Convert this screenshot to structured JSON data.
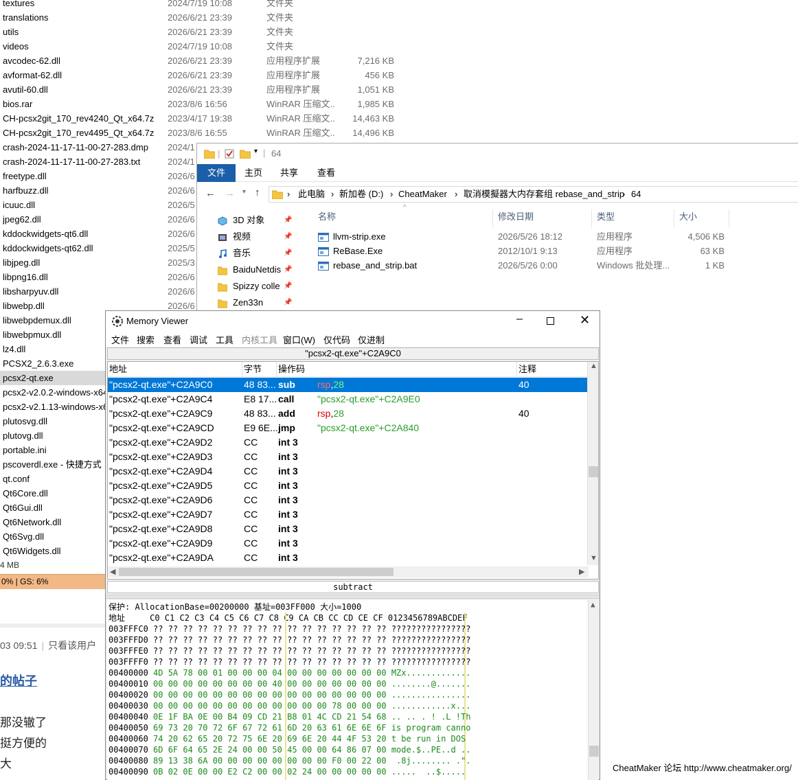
{
  "background_files": {
    "rows": [
      {
        "name": "textures",
        "date": "2024/7/19 10:08",
        "type": "文件夹",
        "size": ""
      },
      {
        "name": "translations",
        "date": "2026/6/21 23:39",
        "type": "文件夹",
        "size": ""
      },
      {
        "name": "utils",
        "date": "2026/6/21 23:39",
        "type": "文件夹",
        "size": ""
      },
      {
        "name": "videos",
        "date": "2024/7/19 10:08",
        "type": "文件夹",
        "size": ""
      },
      {
        "name": "avcodec-62.dll",
        "date": "2026/6/21 23:39",
        "type": "应用程序扩展",
        "size": "7,216 KB"
      },
      {
        "name": "avformat-62.dll",
        "date": "2026/6/21 23:39",
        "type": "应用程序扩展",
        "size": "456 KB"
      },
      {
        "name": "avutil-60.dll",
        "date": "2026/6/21 23:39",
        "type": "应用程序扩展",
        "size": "1,051 KB"
      },
      {
        "name": "bios.rar",
        "date": "2023/8/6 16:56",
        "type": "WinRAR 压缩文...",
        "size": "1,985 KB"
      },
      {
        "name": "CH-pcsx2git_170_rev4240_Qt_x64.7z",
        "date": "2023/4/17 19:38",
        "type": "WinRAR 压缩文...",
        "size": "14,463 KB"
      },
      {
        "name": "CH-pcsx2git_170_rev4495_Qt_x64.7z",
        "date": "2023/8/6 16:55",
        "type": "WinRAR 压缩文...",
        "size": "14,496 KB"
      },
      {
        "name": "crash-2024-11-17-11-00-27-283.dmp",
        "date": "2024/1",
        "type": "",
        "size": ""
      },
      {
        "name": "crash-2024-11-17-11-00-27-283.txt",
        "date": "2024/1",
        "type": "",
        "size": ""
      },
      {
        "name": "freetype.dll",
        "date": "2026/6",
        "type": "",
        "size": ""
      },
      {
        "name": "harfbuzz.dll",
        "date": "2026/6",
        "type": "",
        "size": ""
      },
      {
        "name": "icuuc.dll",
        "date": "2026/5",
        "type": "",
        "size": ""
      },
      {
        "name": "jpeg62.dll",
        "date": "2026/6",
        "type": "",
        "size": ""
      },
      {
        "name": "kddockwidgets-qt6.dll",
        "date": "2026/6",
        "type": "",
        "size": ""
      },
      {
        "name": "kddockwidgets-qt62.dll",
        "date": "2025/5",
        "type": "",
        "size": ""
      },
      {
        "name": "libjpeg.dll",
        "date": "2025/3",
        "type": "",
        "size": ""
      },
      {
        "name": "libpng16.dll",
        "date": "2026/6",
        "type": "",
        "size": ""
      },
      {
        "name": "libsharpyuv.dll",
        "date": "2026/6",
        "type": "",
        "size": ""
      },
      {
        "name": "libwebp.dll",
        "date": "2026/6",
        "type": "",
        "size": ""
      },
      {
        "name": "libwebpdemux.dll",
        "date": "",
        "type": "",
        "size": ""
      },
      {
        "name": "libwebpmux.dll",
        "date": "",
        "type": "",
        "size": ""
      },
      {
        "name": "lz4.dll",
        "date": "",
        "type": "",
        "size": ""
      },
      {
        "name": "PCSX2_2.6.3.exe",
        "date": "",
        "type": "",
        "size": ""
      },
      {
        "name": "pcsx2-qt.exe",
        "date": "",
        "type": "",
        "size": "",
        "selected": true
      },
      {
        "name": "pcsx2-v2.0.2-windows-x64",
        "date": "",
        "type": "",
        "size": ""
      },
      {
        "name": "pcsx2-v2.1.13-windows-x6",
        "date": "",
        "type": "",
        "size": ""
      },
      {
        "name": "plutosvg.dll",
        "date": "",
        "type": "",
        "size": ""
      },
      {
        "name": "plutovg.dll",
        "date": "",
        "type": "",
        "size": ""
      },
      {
        "name": "portable.ini",
        "date": "",
        "type": "",
        "size": ""
      },
      {
        "name": "pscoverdl.exe - 快捷方式",
        "date": "",
        "type": "",
        "size": ""
      },
      {
        "name": "qt.conf",
        "date": "",
        "type": "",
        "size": ""
      },
      {
        "name": "Qt6Core.dll",
        "date": "",
        "type": "",
        "size": ""
      },
      {
        "name": "Qt6Gui.dll",
        "date": "",
        "type": "",
        "size": ""
      },
      {
        "name": "Qt6Network.dll",
        "date": "",
        "type": "",
        "size": ""
      },
      {
        "name": "Qt6Svg.dll",
        "date": "",
        "type": "",
        "size": ""
      },
      {
        "name": "Qt6Widgets.dll",
        "date": "",
        "type": "",
        "size": ""
      }
    ],
    "status_size": "4 MB",
    "status_bar": "0% | GS: 6%",
    "forum_time": "03 09:51",
    "forum_only_user": "只看该用户",
    "forum_link": "的帖子",
    "forum_text_1": "那没辙了",
    "forum_text_2": "挺方便的",
    "forum_text_3": "大"
  },
  "watermark": "CheatMaker 论坛 http://www.cheatmaker.org/",
  "explorer": {
    "title": "64",
    "tabs": [
      "文件",
      "主页",
      "共享",
      "查看"
    ],
    "breadcrumb": [
      "此电脑",
      "新加卷 (D:)",
      "CheatMaker",
      "取消模擬器大内存套组 rebase_and_strip",
      "64"
    ],
    "nav_items": [
      {
        "label": "3D 对象",
        "icon": "3d-objects-icon"
      },
      {
        "label": "视频",
        "icon": "video-icon"
      },
      {
        "label": "音乐",
        "icon": "music-icon"
      },
      {
        "label": "BaiduNetdis",
        "icon": "folder-icon"
      },
      {
        "label": "Spizzy  colle",
        "icon": "folder-icon"
      },
      {
        "label": "Zen33n",
        "icon": "folder-icon"
      }
    ],
    "columns": {
      "name": "名称",
      "date": "修改日期",
      "type": "类型",
      "size": "大小"
    },
    "files": [
      {
        "name": "llvm-strip.exe",
        "date": "2026/5/26 18:12",
        "type": "应用程序",
        "size": "4,506 KB"
      },
      {
        "name": "ReBase.Exe",
        "date": "2012/10/1 9:13",
        "type": "应用程序",
        "size": "63 KB"
      },
      {
        "name": "rebase_and_strip.bat",
        "date": "2026/5/26 0:00",
        "type": "Windows 批处理...",
        "size": "1 KB"
      }
    ]
  },
  "memory_viewer": {
    "title": "Memory Viewer",
    "menu": [
      "文件",
      "搜索",
      "查看",
      "调试",
      "工具",
      "内核工具",
      "窗口(W)",
      "仅代码",
      "仅进制"
    ],
    "current_address": "\"pcsx2-qt.exe\"+C2A9C0",
    "columns": {
      "address": "地址",
      "bytes": "字节",
      "opcode": "操作码",
      "comment": "注释"
    },
    "rows": [
      {
        "address": "\"pcsx2-qt.exe\"+C2A9C0",
        "bytes": "48 83...",
        "op": "sub",
        "reg": "rsp",
        "num": "28",
        "sym": "",
        "comment": "40",
        "selected": true
      },
      {
        "address": "\"pcsx2-qt.exe\"+C2A9C4",
        "bytes": "E8 17...",
        "op": "call",
        "reg": "",
        "num": "",
        "sym": "\"pcsx2-qt.exe\"+C2A9E0",
        "comment": ""
      },
      {
        "address": "\"pcsx2-qt.exe\"+C2A9C9",
        "bytes": "48 83...",
        "op": "add",
        "reg": "rsp",
        "num": "28",
        "sym": "",
        "comment": "40"
      },
      {
        "address": "\"pcsx2-qt.exe\"+C2A9CD",
        "bytes": "E9 6E...",
        "op": "jmp",
        "reg": "",
        "num": "",
        "sym": "\"pcsx2-qt.exe\"+C2A840",
        "comment": ""
      },
      {
        "address": "\"pcsx2-qt.exe\"+C2A9D2",
        "bytes": "CC",
        "op": "int 3",
        "reg": "",
        "num": "",
        "sym": "",
        "comment": ""
      },
      {
        "address": "\"pcsx2-qt.exe\"+C2A9D3",
        "bytes": "CC",
        "op": "int 3",
        "reg": "",
        "num": "",
        "sym": "",
        "comment": ""
      },
      {
        "address": "\"pcsx2-qt.exe\"+C2A9D4",
        "bytes": "CC",
        "op": "int 3",
        "reg": "",
        "num": "",
        "sym": "",
        "comment": ""
      },
      {
        "address": "\"pcsx2-qt.exe\"+C2A9D5",
        "bytes": "CC",
        "op": "int 3",
        "reg": "",
        "num": "",
        "sym": "",
        "comment": ""
      },
      {
        "address": "\"pcsx2-qt.exe\"+C2A9D6",
        "bytes": "CC",
        "op": "int 3",
        "reg": "",
        "num": "",
        "sym": "",
        "comment": ""
      },
      {
        "address": "\"pcsx2-qt.exe\"+C2A9D7",
        "bytes": "CC",
        "op": "int 3",
        "reg": "",
        "num": "",
        "sym": "",
        "comment": ""
      },
      {
        "address": "\"pcsx2-qt.exe\"+C2A9D8",
        "bytes": "CC",
        "op": "int 3",
        "reg": "",
        "num": "",
        "sym": "",
        "comment": ""
      },
      {
        "address": "\"pcsx2-qt.exe\"+C2A9D9",
        "bytes": "CC",
        "op": "int 3",
        "reg": "",
        "num": "",
        "sym": "",
        "comment": ""
      },
      {
        "address": "\"pcsx2-qt.exe\"+C2A9DA",
        "bytes": "CC",
        "op": "int 3",
        "reg": "",
        "num": "",
        "sym": "",
        "comment": ""
      }
    ],
    "instruction_desc": "subtract",
    "hex": {
      "info": "保护: AllocationBase=00200000 基址=003FF000 大小=1000",
      "header": "地址     C0 C1 C2 C3 C4 C5 C6 C7 C8 C9 CA CB CC CD CE CF 0123456789ABCDEF",
      "lines": [
        {
          "addr": "003FFFC0",
          "bytes": "?? ?? ?? ?? ?? ?? ?? ?? ?? ?? ?? ?? ?? ?? ?? ??",
          "ascii": "????????????????",
          "mapped": false
        },
        {
          "addr": "003FFFD0",
          "bytes": "?? ?? ?? ?? ?? ?? ?? ?? ?? ?? ?? ?? ?? ?? ?? ??",
          "ascii": "????????????????",
          "mapped": false
        },
        {
          "addr": "003FFFE0",
          "bytes": "?? ?? ?? ?? ?? ?? ?? ?? ?? ?? ?? ?? ?? ?? ?? ??",
          "ascii": "????????????????",
          "mapped": false
        },
        {
          "addr": "003FFFF0",
          "bytes": "?? ?? ?? ?? ?? ?? ?? ?? ?? ?? ?? ?? ?? ?? ?? ??",
          "ascii": "????????????????",
          "mapped": false
        },
        {
          "addr": "00400000",
          "bytes": "4D 5A 78 00 01 00 00 00 04 00 00 00 00 00 00 00",
          "ascii": "MZx.............",
          "mapped": true
        },
        {
          "addr": "00400010",
          "bytes": "00 00 00 00 00 00 00 00 40 00 00 00 00 00 00 00",
          "ascii": "........@.......",
          "mapped": true
        },
        {
          "addr": "00400020",
          "bytes": "00 00 00 00 00 00 00 00 00 00 00 00 00 00 00 00",
          "ascii": "................",
          "mapped": true
        },
        {
          "addr": "00400030",
          "bytes": "00 00 00 00 00 00 00 00 00 00 00 00 78 00 00 00",
          "ascii": "............x...",
          "mapped": true
        },
        {
          "addr": "00400040",
          "bytes": "0E 1F BA 0E 00 B4 09 CD 21 B8 01 4C CD 21 54 68",
          "ascii": ".. .. . ! .L !Th",
          "mapped": true
        },
        {
          "addr": "00400050",
          "bytes": "69 73 20 70 72 6F 67 72 61 6D 20 63 61 6E 6E 6F",
          "ascii": "is program canno",
          "mapped": true
        },
        {
          "addr": "00400060",
          "bytes": "74 20 62 65 20 72 75 6E 20 69 6E 20 44 4F 53 20",
          "ascii": "t be run in DOS ",
          "mapped": true
        },
        {
          "addr": "00400070",
          "bytes": "6D 6F 64 65 2E 24 00 00 50 45 00 00 64 86 07 00",
          "ascii": "mode.$..PE..d ..",
          "mapped": true
        },
        {
          "addr": "00400080",
          "bytes": "89 13 38 6A 00 00 00 00 00 00 00 00 F0 00 22 00",
          "ascii": " .8j........ .\".",
          "mapped": true
        },
        {
          "addr": "00400090",
          "bytes": "0B 02 0E 00 00 E2 C2 00 00 02 24 00 00 00 00 00",
          "ascii": ".....  ..$.....",
          "mapped": true
        }
      ]
    }
  }
}
